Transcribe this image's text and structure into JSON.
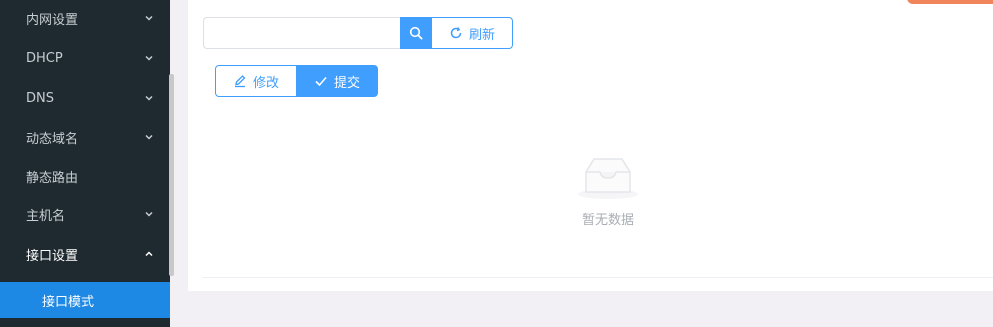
{
  "sidebar": {
    "items": [
      {
        "label": "内网设置"
      },
      {
        "label": "DHCP"
      },
      {
        "label": "DNS"
      },
      {
        "label": "动态域名"
      },
      {
        "label": "静态路由"
      },
      {
        "label": "主机名"
      },
      {
        "label": "接口设置"
      }
    ],
    "active_sub": "接口模式"
  },
  "toolbar": {
    "search_placeholder": "",
    "search_value": "",
    "refresh_label": "刷新",
    "edit_label": "修改",
    "submit_label": "提交"
  },
  "empty": {
    "text": "暂无数据"
  },
  "colors": {
    "accent": "#409eff",
    "sidebar_bg": "#1f2a30",
    "sidebar_active": "#1e88e5",
    "orange": "#f0845a"
  },
  "icons": [
    "chevron-down-icon",
    "chevron-up-icon",
    "search-icon",
    "refresh-icon",
    "edit-icon",
    "check-icon",
    "empty-box-icon"
  ]
}
